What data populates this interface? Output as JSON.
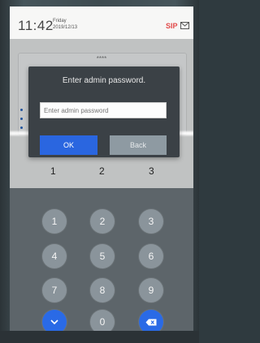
{
  "status": {
    "time": "11:42",
    "weekday": "Friday",
    "date": "2019/12/13",
    "sip_label": "SIP",
    "message_icon": "envelope-icon"
  },
  "background": {
    "password_mask": "****"
  },
  "dialog": {
    "title": "Enter admin password.",
    "input_placeholder": "Enter admin password",
    "ok_label": "OK",
    "back_label": "Back"
  },
  "number_row": [
    "1",
    "2",
    "3"
  ],
  "keypad": {
    "keys": [
      "1",
      "2",
      "3",
      "4",
      "5",
      "6",
      "7",
      "8",
      "9"
    ],
    "zero": "0",
    "down_icon": "chevron-down-icon",
    "delete_icon": "backspace-icon"
  },
  "colors": {
    "accent": "#2a66e0",
    "sip": "#e24a4a"
  }
}
